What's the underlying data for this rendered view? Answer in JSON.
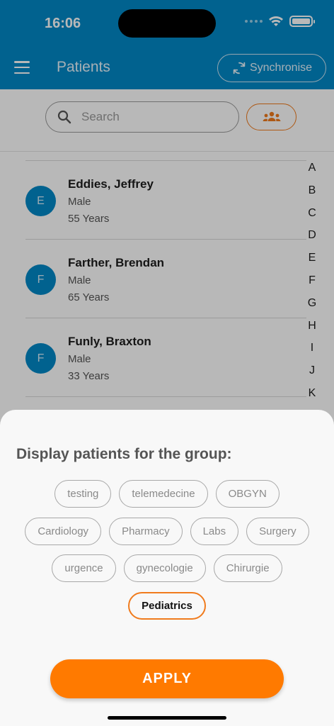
{
  "status_bar": {
    "time": "16:06",
    "wifi_icon": "wifi-icon",
    "battery_icon": "battery-icon"
  },
  "header": {
    "menu_icon": "hamburger-menu-icon",
    "title": "Patients",
    "sync_label": "Synchronise",
    "sync_icon": "sync-icon",
    "color": "#0288c7"
  },
  "search": {
    "placeholder": "Search",
    "icon": "search-icon",
    "group_filter_icon": "group-people-icon"
  },
  "patients": [
    {
      "initial": "E",
      "name": "Eddies, Jeffrey",
      "gender": "Male",
      "age": "55 Years"
    },
    {
      "initial": "F",
      "name": "Farther, Brendan",
      "gender": "Male",
      "age": "65 Years"
    },
    {
      "initial": "F",
      "name": "Funly, Braxton",
      "gender": "Male",
      "age": "33 Years"
    }
  ],
  "alphabet_index": [
    "A",
    "B",
    "C",
    "D",
    "E",
    "F",
    "G",
    "H",
    "I",
    "J",
    "K"
  ],
  "group_sheet": {
    "title": "Display patients for the group:",
    "groups": [
      {
        "label": "testing",
        "selected": false
      },
      {
        "label": "telemedecine",
        "selected": false
      },
      {
        "label": "OBGYN",
        "selected": false
      },
      {
        "label": "Cardiology",
        "selected": false
      },
      {
        "label": "Pharmacy",
        "selected": false
      },
      {
        "label": "Labs",
        "selected": false
      },
      {
        "label": "Surgery",
        "selected": false
      },
      {
        "label": "urgence",
        "selected": false
      },
      {
        "label": "gynecologie",
        "selected": false
      },
      {
        "label": "Chirurgie",
        "selected": false
      },
      {
        "label": "Pediatrics",
        "selected": true
      }
    ],
    "apply_label": "APPLY",
    "accent_color": "#ff7a00"
  }
}
